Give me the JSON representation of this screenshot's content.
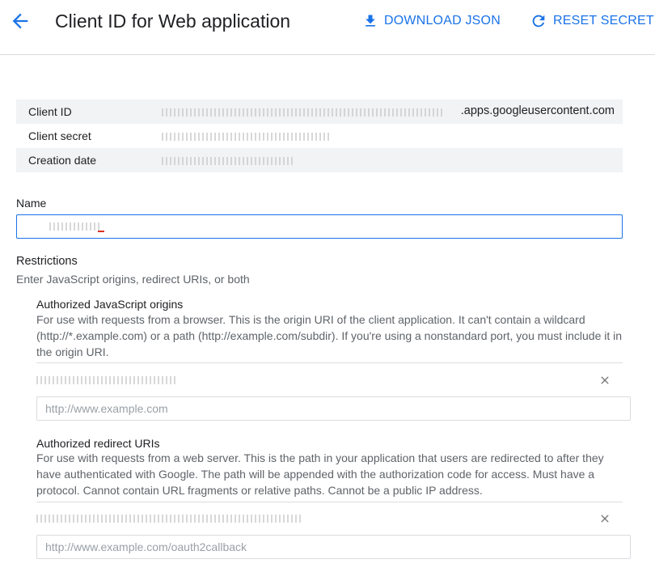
{
  "header": {
    "title": "Client ID for Web application",
    "download_label": "DOWNLOAD JSON",
    "reset_label": "RESET SECRET",
    "accent": "#1a73e8"
  },
  "info": {
    "client_id_label": "Client ID",
    "client_id_suffix": ".apps.googleusercontent.com",
    "client_secret_label": "Client secret",
    "creation_date_label": "Creation date"
  },
  "name": {
    "label": "Name"
  },
  "restrictions": {
    "title": "Restrictions",
    "subtitle": "Enter JavaScript origins, redirect URIs, or both"
  },
  "js_origins": {
    "title": "Authorized JavaScript origins",
    "description": "For use with requests from a browser. This is the origin URI of the client application. It can't contain a wildcard (http://*.example.com) or a path (http://example.com/subdir). If you're using a nonstandard port, you must include it in the origin URI.",
    "placeholder": "http://www.example.com"
  },
  "redirect_uris": {
    "title": "Authorized redirect URIs",
    "description": "For use with requests from a web server. This is the path in your application that users are redirected to after they have authenticated with Google. The path will be appended with the authorization code for access. Must have a protocol. Cannot contain URL fragments or relative paths. Cannot be a public IP address.",
    "placeholder": "http://www.example.com/oauth2callback"
  },
  "icons": {
    "back": "arrow-back-icon",
    "download": "download-icon",
    "reset": "refresh-icon",
    "remove": "close-icon"
  }
}
